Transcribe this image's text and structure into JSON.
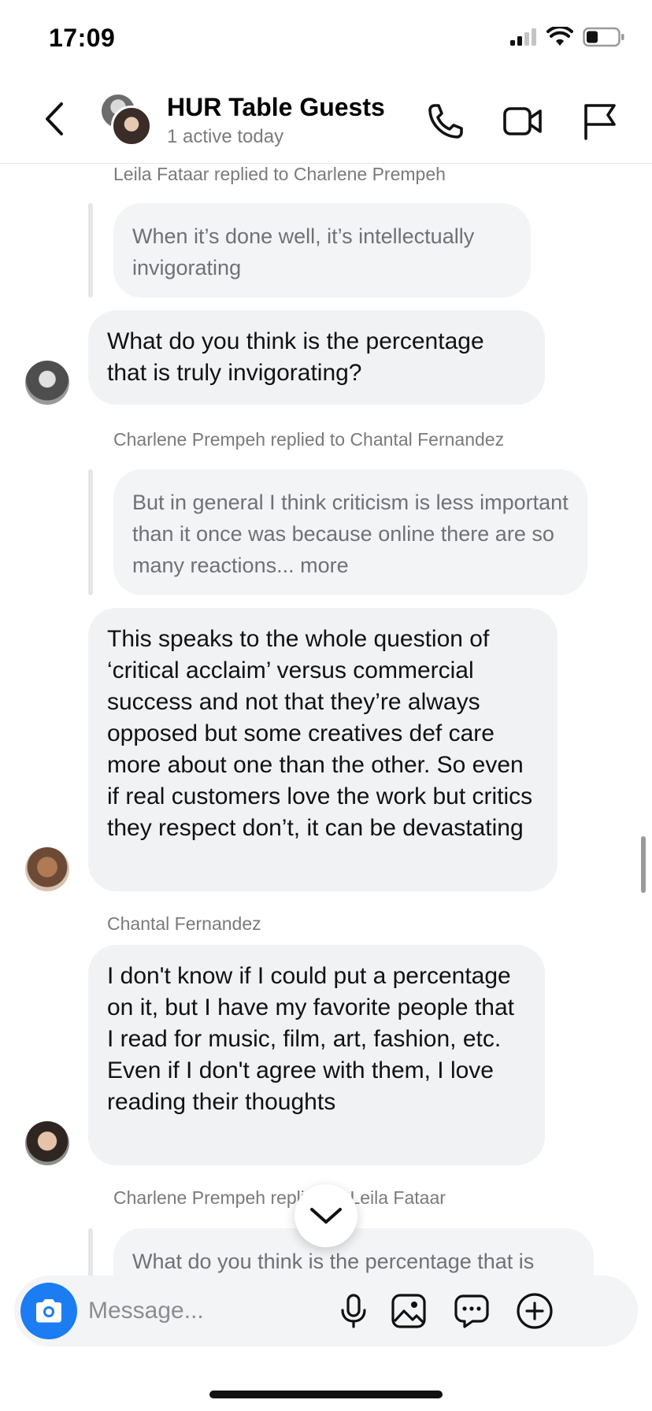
{
  "status_bar": {
    "time": "17:09"
  },
  "header": {
    "title": "HUR Table Guests",
    "subtitle": "1 active today"
  },
  "messages": [
    {
      "reply_meta": "Leila Fataar replied to Charlene Prempeh",
      "quoted_text": "When it’s done well, it’s intellectually invigorating",
      "text": "What do you think is the percentage that is truly invigorating?"
    },
    {
      "reply_meta": "Charlene Prempeh replied to Chantal Fernandez",
      "quoted_text": "But in general I think criticism is less important than it once was because online there are so many reactions... more",
      "text": "This speaks to the whole question of ‘critical acclaim’ versus commercial success and not that they’re always opposed but some creatives def care more about one than the other. So even if real customers love the work but critics they respect don’t, it can be devastating"
    },
    {
      "sender": "Chantal Fernandez",
      "text": "I don't know if I could put a percentage on it, but I have my favorite people that I read for music, film, art, fashion, etc. Even if I don't agree with them, I love reading their thoughts"
    },
    {
      "reply_meta": "Charlene Prempeh replied to Leila Fataar",
      "quoted_text": "What do you think is the percentage that is"
    }
  ],
  "composer": {
    "placeholder": "Message..."
  },
  "colors": {
    "accent": "#1c7cf2",
    "bubble": "#f1f2f4",
    "muted_text": "#7a7a7a"
  }
}
